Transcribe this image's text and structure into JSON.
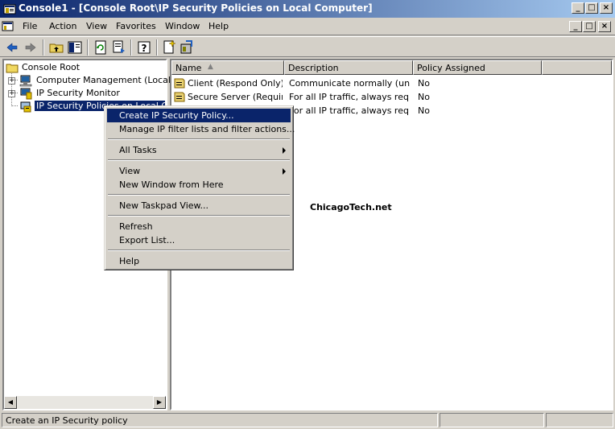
{
  "window": {
    "title": "Console1 - [Console Root\\IP Security Policies on Local Computer]",
    "minimize": "_",
    "maximize": "□",
    "close": "×"
  },
  "menubar": {
    "items": [
      "File",
      "Action",
      "View",
      "Favorites",
      "Window",
      "Help"
    ]
  },
  "tree": {
    "root": "Console Root",
    "items": [
      {
        "label": "Computer Management (Local)"
      },
      {
        "label": "IP Security Monitor"
      },
      {
        "label": "IP Security Policies on Local Comp"
      }
    ]
  },
  "list": {
    "columns": [
      "Name",
      "Description",
      "Policy Assigned"
    ],
    "rows": [
      {
        "name": "Client (Respond Only)",
        "description": "Communicate normally (uns...",
        "assigned": "No"
      },
      {
        "name": "Secure Server (Requir...",
        "description": "For all IP traffic, always req...",
        "assigned": "No"
      },
      {
        "name": "",
        "description": "For all IP traffic, always req...",
        "assigned": "No"
      }
    ]
  },
  "context_menu": {
    "items": [
      "Create IP Security Policy...",
      "Manage IP filter lists and filter actions...",
      "All Tasks",
      "View",
      "New Window from Here",
      "New Taskpad View...",
      "Refresh",
      "Export List...",
      "Help"
    ],
    "highlight_color": "#0a246a"
  },
  "watermark": "ChicagoTech.net",
  "status": {
    "text": "Create an IP Security policy"
  }
}
